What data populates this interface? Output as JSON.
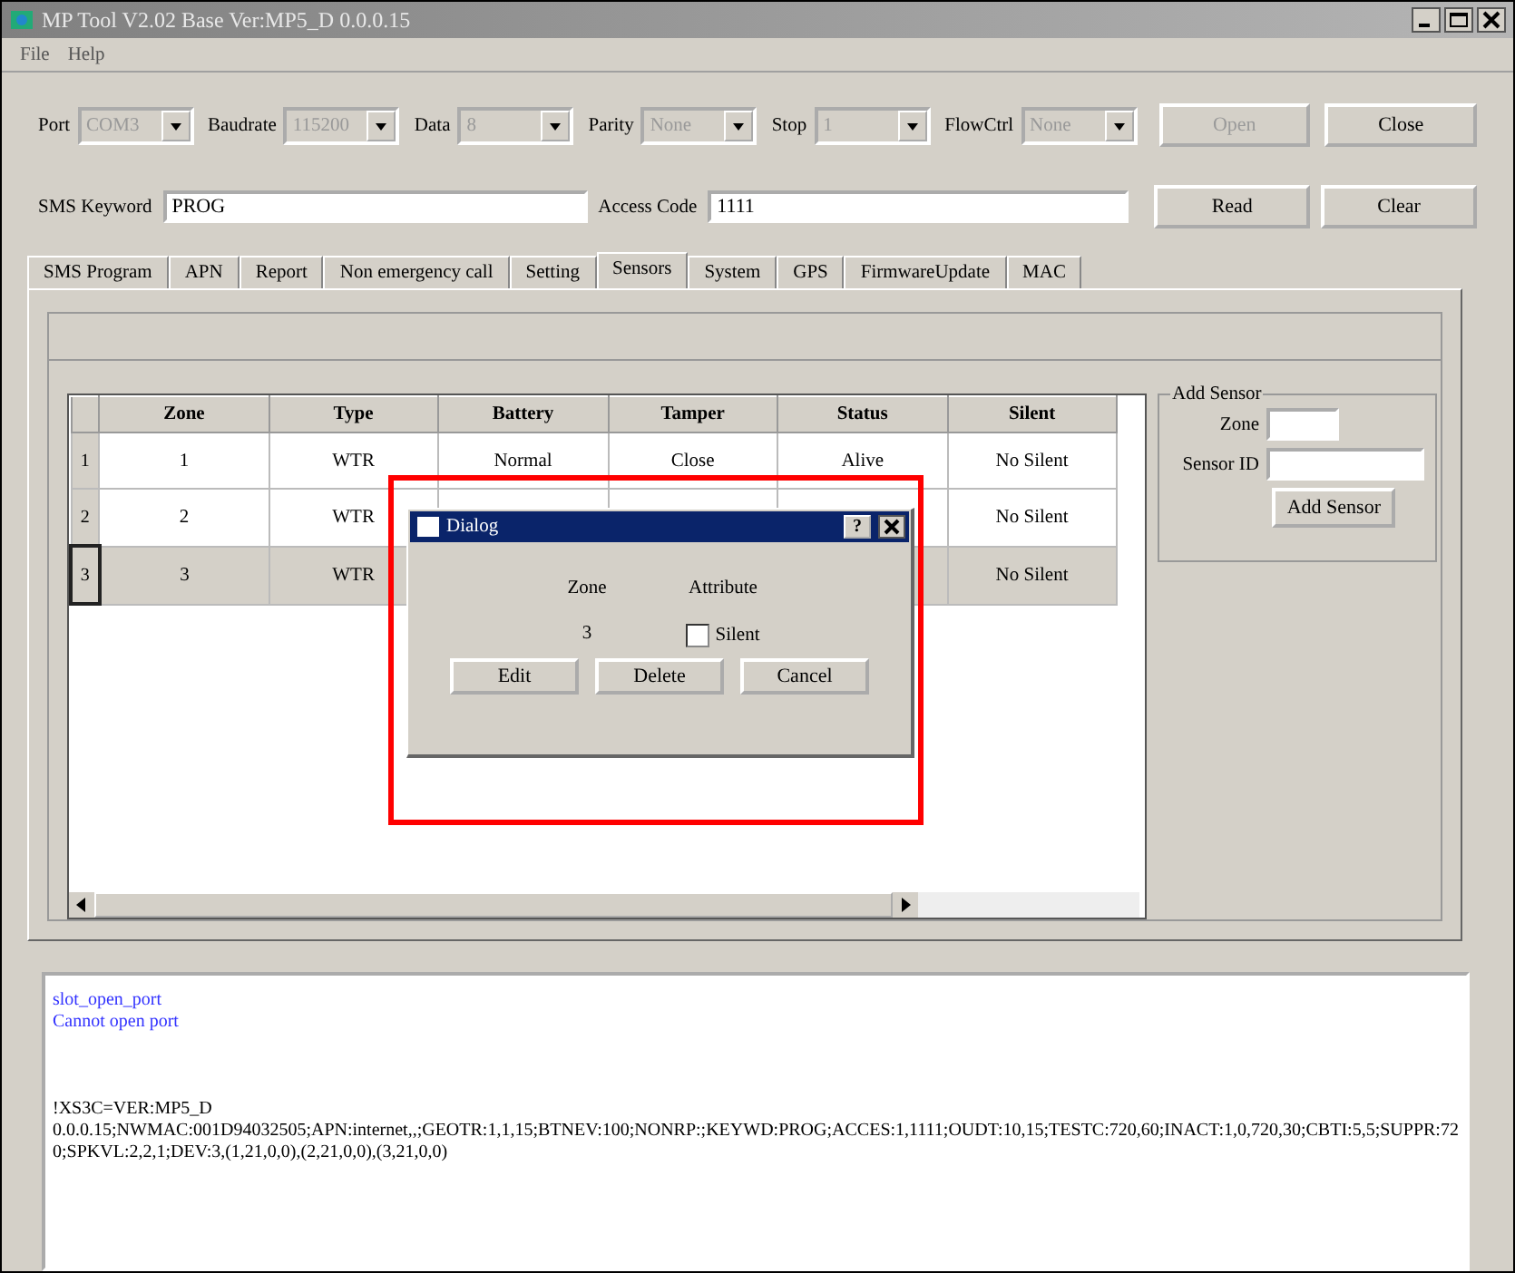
{
  "window": {
    "title": "MP Tool V2.02  Base Ver:MP5_D 0.0.0.15"
  },
  "menu": [
    "File",
    "Help"
  ],
  "serial": [
    {
      "label": "Port",
      "value": "COM3",
      "disabled": true
    },
    {
      "label": "Baudrate",
      "value": "115200",
      "disabled": true
    },
    {
      "label": "Data",
      "value": "8",
      "disabled": true
    },
    {
      "label": "Parity",
      "value": "None",
      "disabled": true
    },
    {
      "label": "Stop",
      "value": "1",
      "disabled": true
    },
    {
      "label": "FlowCtrl",
      "value": "None",
      "disabled": true
    }
  ],
  "serial_buttons": [
    {
      "label": "Open",
      "disabled": true
    },
    {
      "label": "Close",
      "disabled": false
    }
  ],
  "sms": {
    "keyword_label": "SMS Keyword",
    "keyword": "PROG",
    "access_label": "Access Code",
    "access": "1111"
  },
  "sms_buttons": [
    {
      "label": "Read",
      "disabled": false
    },
    {
      "label": "Clear",
      "disabled": false
    }
  ],
  "tabs": [
    {
      "label": "SMS Program",
      "selected": false
    },
    {
      "label": "APN",
      "selected": false
    },
    {
      "label": "Report",
      "selected": false
    },
    {
      "label": "Non emergency call",
      "selected": false
    },
    {
      "label": "Setting",
      "selected": false
    },
    {
      "label": "Sensors",
      "selected": true
    },
    {
      "label": "System",
      "selected": false
    },
    {
      "label": "GPS",
      "selected": false
    },
    {
      "label": "FirmwareUpdate",
      "selected": false
    },
    {
      "label": "MAC",
      "selected": false
    }
  ],
  "table": {
    "columns": [
      "Zone",
      "Type",
      "Battery",
      "Tamper",
      "Status",
      "Silent"
    ],
    "rows": [
      {
        "header": "1",
        "selected": false,
        "zone": "1",
        "type": "WTR",
        "battery": "Normal",
        "tamper": "Close",
        "status": "Alive",
        "silent": "No Silent"
      },
      {
        "header": "2",
        "selected": false,
        "zone": "2",
        "type": "WTR",
        "silent": "No Silent"
      },
      {
        "header": "3",
        "selected": true,
        "zone": "3",
        "type": "WTR",
        "silent": "No Silent"
      }
    ]
  },
  "add_sensor": {
    "title": "Add Sensor",
    "zone_label": "Zone",
    "id_label": "Sensor ID",
    "button": "Add Sensor"
  },
  "dialog": {
    "title": "Dialog",
    "help": "?",
    "zone_label": "Zone",
    "attribute_label": "Attribute",
    "zone": "3",
    "silent_label": "Silent",
    "silent_checked": false,
    "buttons": [
      "Edit",
      "Delete",
      "Cancel"
    ]
  },
  "log": [
    {
      "kind": "info",
      "text": "slot_open_port"
    },
    {
      "kind": "info",
      "text": "Cannot open port"
    },
    {
      "kind": "data",
      "text": "!XS3C=VER:MP5_D"
    },
    {
      "kind": "data",
      "text": "0.0.0.15;NWMAC:001D94032505;APN:internet,,;GEOTR:1,1,15;BTNEV:100;NONRP:;KEYWD:PROG;ACCES:1,1111;OUDT:10,15;TESTC:720,60;INACT:1,0,720,30;CBTI:5,5;SUPPR:720;SPKVL:2,2,1;DEV:3,(1,21,0,0),(2,21,0,0),(3,21,0,0)"
    }
  ]
}
